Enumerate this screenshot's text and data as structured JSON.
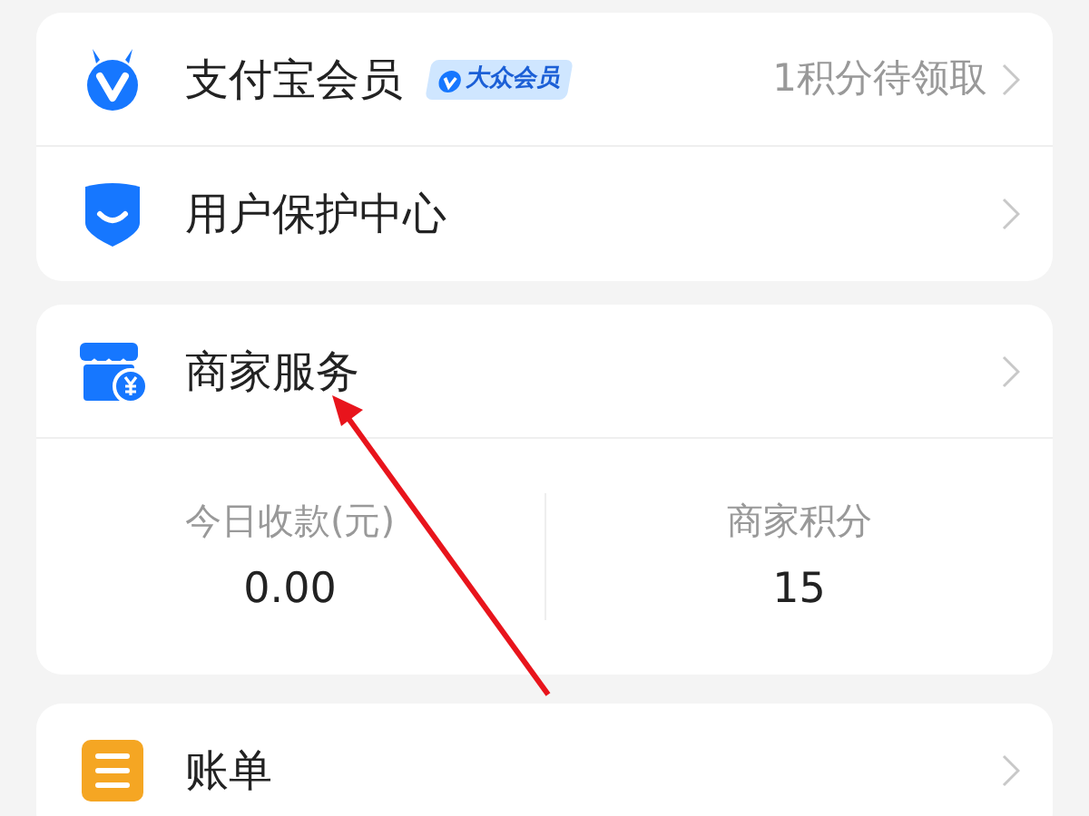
{
  "cards": [
    {
      "rows": [
        {
          "kind": "member",
          "title": "支付宝会员",
          "badge": "大众会员",
          "detail": "1积分待领取"
        },
        {
          "kind": "shield",
          "title": "用户保护中心"
        }
      ]
    },
    {
      "rows": [
        {
          "kind": "store",
          "title": "商家服务"
        }
      ],
      "stats": [
        {
          "label": "今日收款(元)",
          "value": "0.00"
        },
        {
          "label": "商家积分",
          "value": "15"
        }
      ]
    },
    {
      "rows": [
        {
          "kind": "bill",
          "title": "账单"
        }
      ]
    }
  ]
}
